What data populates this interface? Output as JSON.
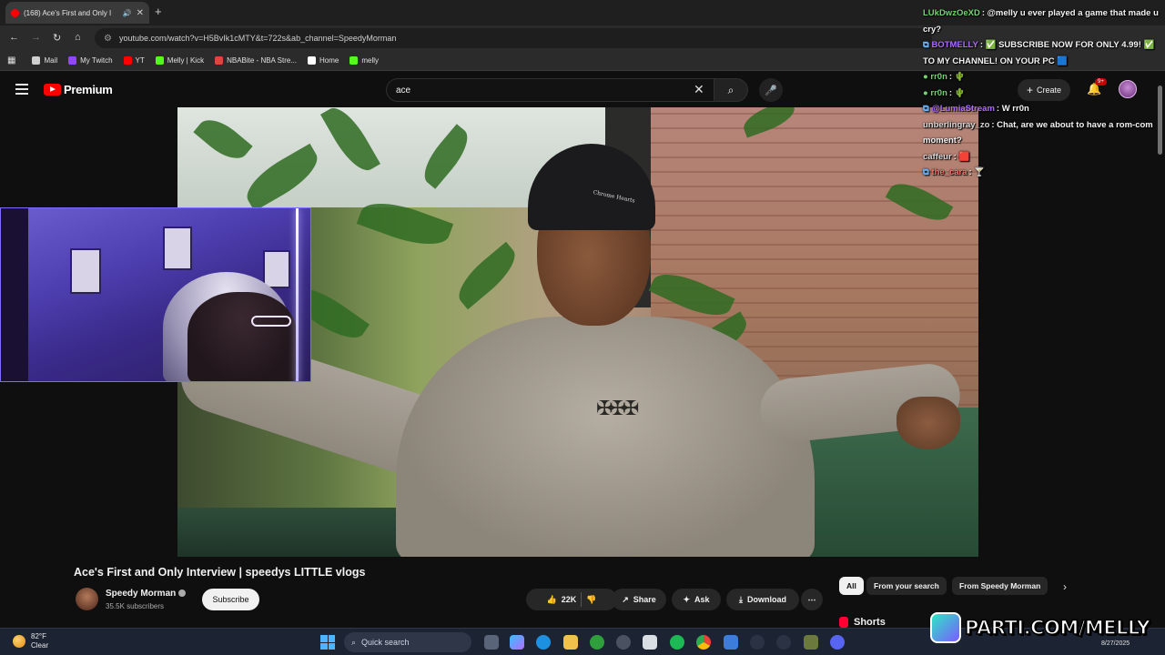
{
  "browser": {
    "tab_title": "(168) Ace's First and Only I",
    "tab_close": "✕",
    "new_tab": "+",
    "url": "youtube.com/watch?v=H5BvIk1cMTY&t=722s&ab_channel=SpeedyMorman",
    "bookmarks": [
      {
        "label": "Mail",
        "color": "#d0d0d0"
      },
      {
        "label": "My Twitch",
        "color": "#9146ff"
      },
      {
        "label": "YT",
        "color": "#ff0000"
      },
      {
        "label": "Melly | Kick",
        "color": "#53fc18"
      },
      {
        "label": "NBABite - NBA Stre...",
        "color": "#e0443e"
      },
      {
        "label": "Home",
        "color": "#ffffff"
      },
      {
        "label": "melly",
        "color": "#53fc18"
      }
    ]
  },
  "youtube": {
    "logo_text": "Premium",
    "search_value": "ace",
    "create_label": "Create",
    "notifications_badge": "9+"
  },
  "video": {
    "title": "Ace's First and Only Interview | speedys LITTLE vlogs",
    "channel_name": "Speedy Morman",
    "subscribers": "35.5K subscribers",
    "subscribe_label": "Subscribe",
    "likes": "22K",
    "share_label": "Share",
    "ask_label": "Ask",
    "download_label": "Download",
    "more_label": "⋯",
    "beanie_text": "Chrome Hearts"
  },
  "chips": {
    "all": "All",
    "from_search": "From your search",
    "from_channel": "From Speedy Morman"
  },
  "shorts_label": "Shorts",
  "chat": [
    {
      "user": "LUkDwzOeXD",
      "user_color": "#6fd76f",
      "text": ": @melly u ever played a game that made u cry?"
    },
    {
      "user": "BOTMELLY",
      "user_color": "#b06cff",
      "text": ": ✅ SUBSCRIBE NOW FOR ONLY 4.99! ✅ TO MY CHANNEL! ON YOUR PC 🟦"
    },
    {
      "user": "rr0n",
      "user_color": "#6fd76f",
      "text": ": 🌵"
    },
    {
      "user": "rr0n",
      "user_color": "#6fd76f",
      "text": ": 🌵"
    },
    {
      "user": "@LumiaStream",
      "user_color": "#b06cff",
      "text": ": W rr0n"
    },
    {
      "user": "unberlingray_zo",
      "user_color": "#d8d8d8",
      "text": ": Chat, are we about to have a rom-com moment?"
    },
    {
      "user": "caffeur",
      "user_color": "#d8d8d8",
      "text": ": 🟥"
    },
    {
      "user": "the_cara",
      "user_color": "#ff6f6f",
      "text": ": 🍸"
    }
  ],
  "taskbar": {
    "temperature": "82°F",
    "condition": "Clear",
    "search_placeholder": "Quick search",
    "date": "8/27/2025"
  },
  "watermark": "PARTI.COM/MELLY"
}
